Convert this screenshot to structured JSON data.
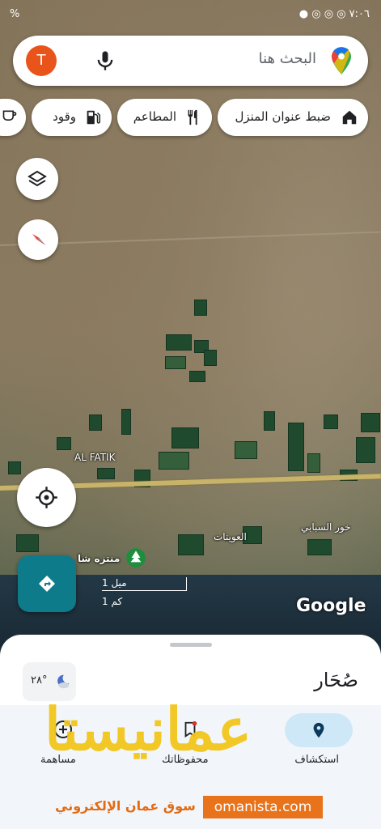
{
  "status_bar": {
    "time": "٧:٠٦",
    "left_text": "%"
  },
  "search": {
    "placeholder": "البحث هنا",
    "avatar_letter": "T"
  },
  "chips": [
    {
      "label": "ضبط عنوان المنزل",
      "icon": "home-icon"
    },
    {
      "label": "المطاعم",
      "icon": "restaurant-icon"
    },
    {
      "label": "وقود",
      "icon": "gas-station-icon"
    }
  ],
  "map_labels": {
    "al_fatik": "AL FATIK",
    "awaynat": "العوينات",
    "khor_sabahi": "خور السبابي",
    "park": "منتزه شا",
    "scale_mile": "1 ميل",
    "scale_km": "1 كم",
    "google": "Google"
  },
  "sheet": {
    "place_name": "صُحَار",
    "weather": "٢٨°"
  },
  "bottom_nav": [
    {
      "label": "استكشاف",
      "icon": "explore-icon"
    },
    {
      "label": "محفوظاتك",
      "icon": "bookmark-icon"
    },
    {
      "label": "مساهمة",
      "icon": "add-icon"
    }
  ],
  "watermark": {
    "arabic_logo": "عمانيستا",
    "tagline": "سوق عمان الإلكتروني",
    "url": "omanista.com"
  }
}
